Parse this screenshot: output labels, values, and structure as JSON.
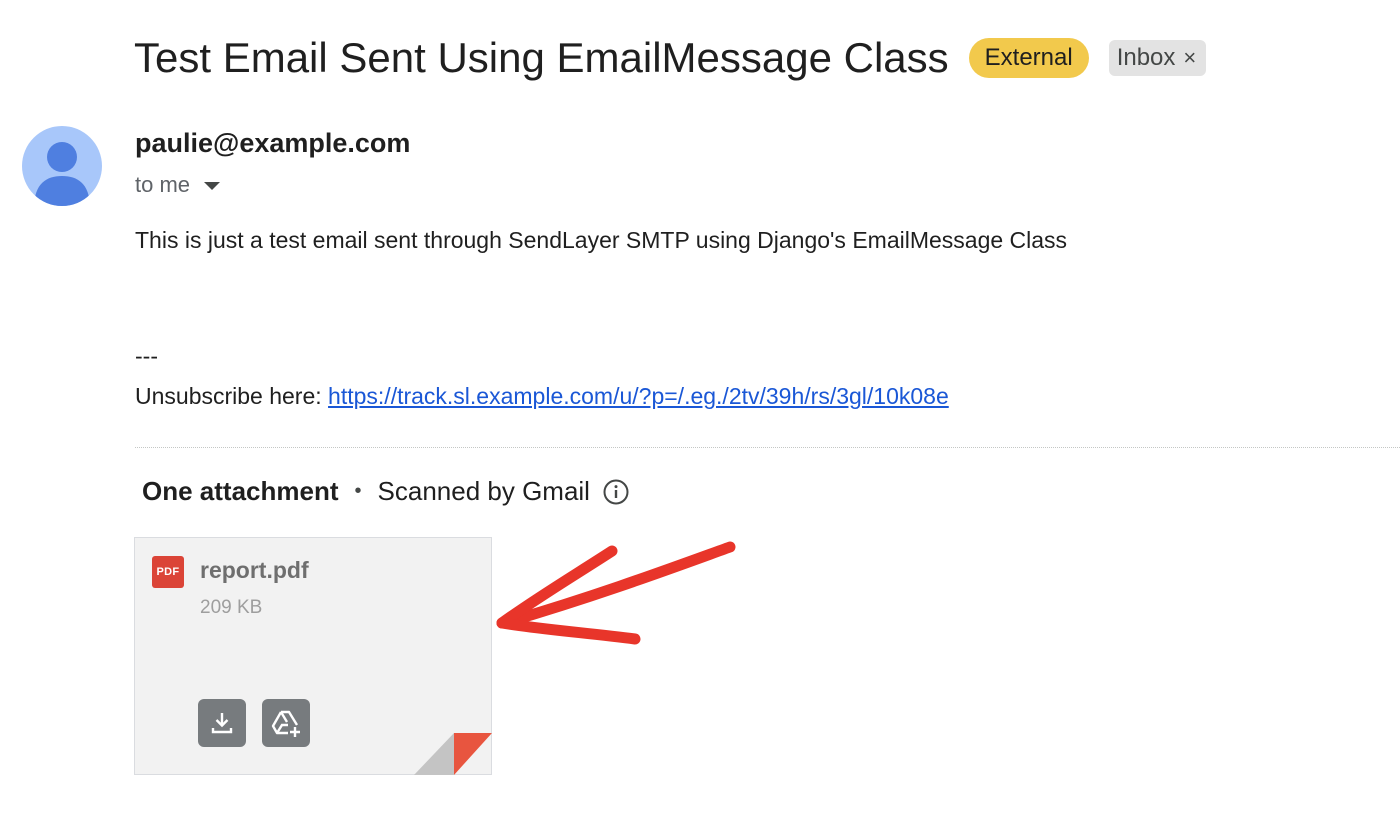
{
  "email": {
    "subject": "Test Email Sent Using EmailMessage Class",
    "labels": {
      "external": "External",
      "inbox": "Inbox",
      "inbox_remove": "×"
    },
    "sender": "paulie@example.com",
    "recipient_summary": "to me",
    "body_text": "This is just a test email sent through SendLayer SMTP using Django's EmailMessage Class",
    "signature_separator": "---",
    "unsubscribe_label": "Unsubscribe here: ",
    "unsubscribe_link": "https://track.sl.example.com/u/?p=/.eg./2tv/39h/rs/3gl/10k08e"
  },
  "attachments": {
    "count_label": "One attachment",
    "separator": "•",
    "scanned_label": "Scanned by Gmail",
    "items": [
      {
        "type_badge": "PDF",
        "name": "report.pdf",
        "size": "209 KB"
      }
    ]
  },
  "icons": {
    "avatar": "person-avatar-icon",
    "caret": "caret-down-icon",
    "info": "info-icon",
    "file": "pdf-file-icon",
    "download": "download-icon",
    "drive": "add-to-drive-icon",
    "annotation": "red-arrow-annotation"
  },
  "colors": {
    "external_badge": "#f2c94c",
    "inbox_badge": "#e3e3e3",
    "link": "#1a57d6",
    "avatar_bg": "#a8c7fa",
    "avatar_fg": "#4f7fe0",
    "pdf_red": "#db4437",
    "annotation_red": "#e8352a"
  }
}
